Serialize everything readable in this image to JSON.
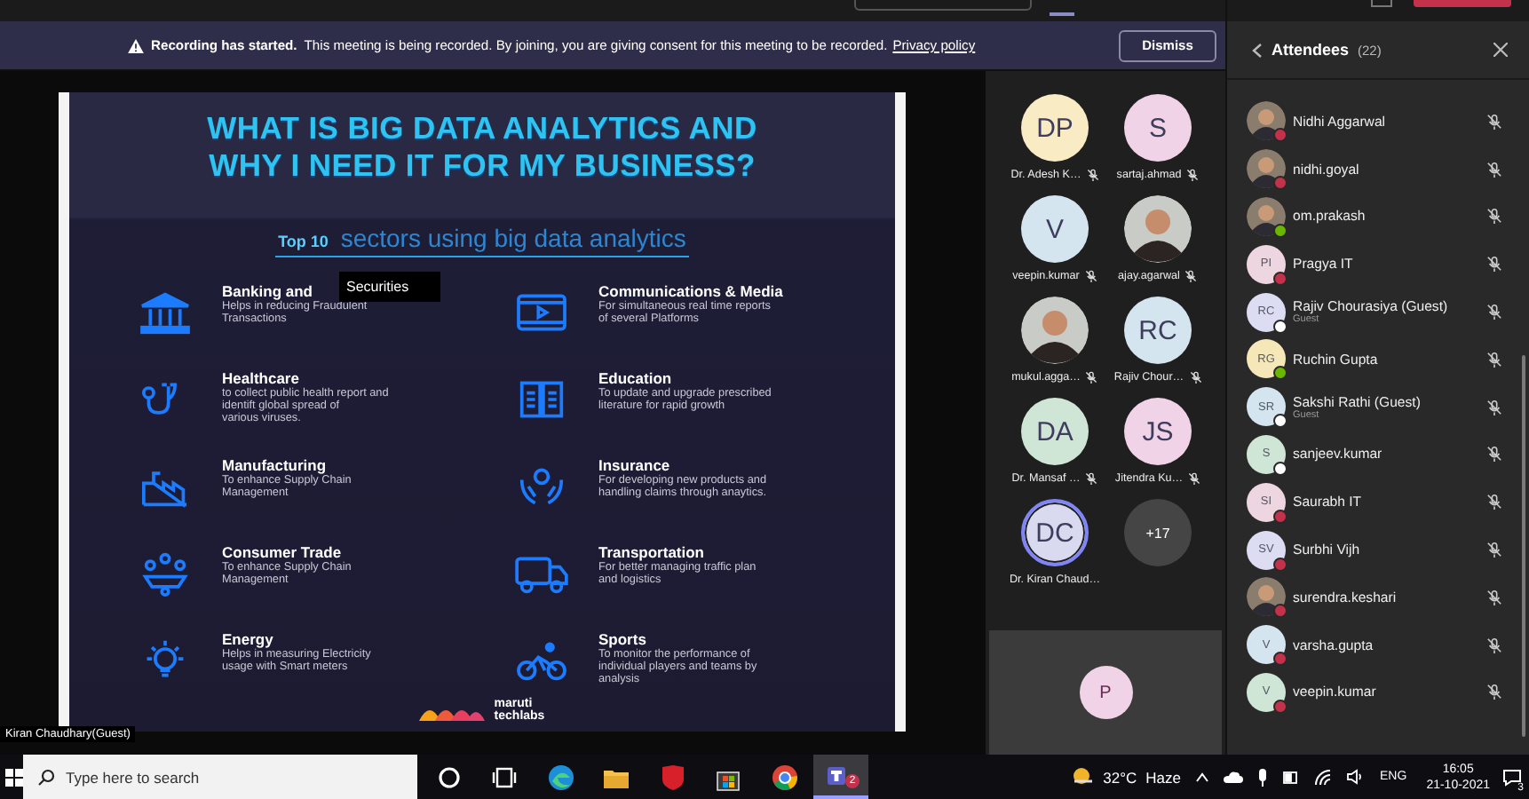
{
  "banner": {
    "title": "Recording has started.",
    "message": "This meeting is being recorded. By joining, you are giving consent for this meeting to be recorded.",
    "link": "Privacy policy",
    "button": "Dismiss"
  },
  "slide": {
    "title_lines": [
      "WHAT IS BIG DATA ANALYTICS AND",
      "WHY I NEED IT FOR MY BUSINESS?"
    ],
    "subtitle": "**Top 10** sectors using big data analytics",
    "sectors": [
      {
        "kind": "bank",
        "name": "Banking and",
        "description_lines": [
          "Helps in reducing Fraudulent",
          "Transactions"
        ]
      },
      {
        "kind": "film",
        "name": "Communications & Media",
        "description_lines": [
          "For simultaneous real time reports",
          "of several Platforms"
        ]
      },
      {
        "kind": "stethoscope",
        "name": "Healthcare",
        "description_lines": [
          "to collect public health report and",
          "identift global spread of",
          "various viruses."
        ]
      },
      {
        "kind": "book",
        "name": "Education",
        "description_lines": [
          "To update and upgrade prescribed",
          "literature for rapid growth"
        ]
      },
      {
        "kind": "factory",
        "name": "Manufacturing",
        "description_lines": [
          "To enhance Supply Chain",
          "Management"
        ]
      },
      {
        "kind": "hands",
        "name": "Insurance",
        "description_lines": [
          "For developing new products and",
          "handling claims through anaytics."
        ]
      },
      {
        "kind": "meeting",
        "name": "Consumer Trade",
        "description_lines": [
          "To enhance Supply Chain",
          "Management"
        ]
      },
      {
        "kind": "truck",
        "name": "Transportation",
        "description_lines": [
          "For better managing traffic plan",
          "and logistics"
        ]
      },
      {
        "kind": "bulb",
        "name": "Energy",
        "description_lines": [
          "Helps in measuring Electricity",
          "usage with Smart meters"
        ]
      },
      {
        "kind": "bike",
        "name": "Sports",
        "description_lines": [
          "To monitor the performance of",
          "individual players and teams by",
          "analysis"
        ]
      }
    ],
    "tooltip": "Securities",
    "logo_lines": [
      "maruti",
      "techlabs"
    ]
  },
  "presenter_label": "Kiran Chaudhary(Guest)",
  "participants": [
    {
      "kind": "initials",
      "initials": "DP",
      "name": "Dr. Adesh K…",
      "color": "#f9ecc5",
      "muted": true,
      "speaking": false
    },
    {
      "kind": "initials",
      "initials": "V",
      "name": "veepin.kumar",
      "color": "#d5e5ef",
      "muted": true,
      "speaking": false
    },
    {
      "kind": "picture",
      "name": "mukul.agga…",
      "muted": true,
      "speaking": false
    },
    {
      "kind": "initials",
      "initials": "DA",
      "name": "Dr. Mansaf …",
      "color": "#cfe5d6",
      "muted": true,
      "speaking": false
    },
    {
      "kind": "initials",
      "initials": "DC",
      "name": "Dr. Kiran Chaud…",
      "color": "#d9d9f0",
      "muted": false,
      "speaking": true
    },
    {
      "kind": "initials",
      "initials": "S",
      "name": "sartaj.ahmad",
      "color": "#f0d3e6",
      "muted": true,
      "speaking": false
    },
    {
      "kind": "picture",
      "name": "ajay.agarwal",
      "muted": true,
      "speaking": false
    },
    {
      "kind": "initials",
      "initials": "RC",
      "name": "Rajiv Chour…",
      "color": "#d5e5ef",
      "muted": true,
      "speaking": false
    },
    {
      "kind": "initials",
      "initials": "JS",
      "name": "Jitendra Ku…",
      "color": "#f0d3e6",
      "muted": true,
      "speaking": false
    }
  ],
  "more_count": "+17",
  "self_tile": {
    "initials": "P",
    "color": "#f0d3e6"
  },
  "attendees": {
    "title": "Attendees",
    "count": "(22)",
    "people": [
      {
        "kind": "picture",
        "name": "Nidhi Aggarwal",
        "color": "#c4314b",
        "muted": true
      },
      {
        "kind": "picture",
        "name": "nidhi.goyal",
        "color": "#c4314b",
        "muted": true
      },
      {
        "kind": "picture",
        "name": "om.prakash",
        "color": "#6bb700",
        "muted": true
      },
      {
        "kind": "initials",
        "initials": "PI",
        "name": "Pragya IT",
        "color": "#c4314b",
        "muted": true
      },
      {
        "kind": "initials",
        "initials": "RC",
        "name": "Rajiv Chourasiya (Guest)",
        "subtitle": "Guest",
        "color": "#ffffff",
        "muted": true
      },
      {
        "kind": "initials",
        "initials": "RG",
        "name": "Ruchin Gupta",
        "color": "#6bb700",
        "muted": true
      },
      {
        "kind": "initials",
        "initials": "SR",
        "name": "Sakshi Rathi (Guest)",
        "subtitle": "Guest",
        "color": "#ffffff",
        "muted": true
      },
      {
        "kind": "initials",
        "initials": "S",
        "name": "sanjeev.kumar",
        "color": "#ffffff",
        "muted": true
      },
      {
        "kind": "initials",
        "initials": "SI",
        "name": "Saurabh IT",
        "color": "#c4314b",
        "muted": true
      },
      {
        "kind": "initials",
        "initials": "SV",
        "name": "Surbhi Vijh",
        "color": "#c4314b",
        "muted": true
      },
      {
        "kind": "picture",
        "name": "surendra.keshari",
        "color": "#c4314b",
        "muted": true
      },
      {
        "kind": "initials",
        "initials": "V",
        "name": "varsha.gupta",
        "color": "#c4314b",
        "muted": true
      },
      {
        "kind": "initials",
        "initials": "V",
        "name": "veepin.kumar",
        "color": "#c4314b",
        "muted": true
      }
    ]
  },
  "taskbar": {
    "search_placeholder": "Type here to search",
    "apps": [
      {
        "kind": "cortana",
        "selected": false
      },
      {
        "kind": "taskview",
        "selected": false
      },
      {
        "kind": "edge",
        "selected": false
      },
      {
        "kind": "folder",
        "selected": false
      },
      {
        "kind": "mcafee",
        "selected": false
      },
      {
        "kind": "store",
        "selected": false
      },
      {
        "kind": "chrome",
        "selected": false
      },
      {
        "kind": "teams",
        "selected": true,
        "badge": "2"
      }
    ],
    "temperature": "32°C",
    "weather": "Haze",
    "language": "ENG",
    "time": "16:05",
    "date": "21-10-2021",
    "notifications": "3"
  }
}
